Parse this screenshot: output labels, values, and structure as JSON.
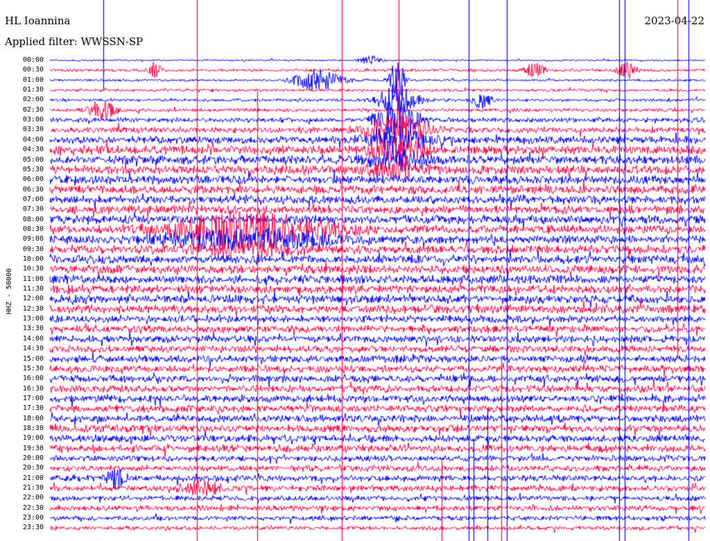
{
  "header": {
    "station": "HL Ioannina",
    "filter_prefix": "Applied filter: ",
    "filter_name": "WWSSN-SP",
    "date": "2023-04-22"
  },
  "chart_data": {
    "type": "line",
    "subtype": "helicorder",
    "title": "HL Ioannina",
    "date": "2023-04-22",
    "filter": "WWSSN-SP",
    "ylabel": "HHZ - 50000",
    "grid": false,
    "row_interval_minutes": 30,
    "alternating_colors": [
      "#0000ff",
      "#ff0040"
    ],
    "colors": {
      "blue_trace": "#0000ff",
      "red_trace": "#ff0040"
    },
    "time_labels": [
      "00:00",
      "00:30",
      "01:00",
      "01:30",
      "02:00",
      "02:30",
      "03:00",
      "03:30",
      "04:00",
      "04:30",
      "05:00",
      "05:30",
      "06:00",
      "06:30",
      "07:00",
      "07:30",
      "08:00",
      "08:30",
      "09:00",
      "09:30",
      "10:00",
      "10:30",
      "11:00",
      "11:30",
      "12:00",
      "12:30",
      "13:00",
      "13:30",
      "14:00",
      "14:30",
      "15:00",
      "15:30",
      "16:00",
      "16:30",
      "17:00",
      "17:30",
      "18:00",
      "18:30",
      "19:00",
      "19:30",
      "20:00",
      "20:30",
      "21:00",
      "21:30",
      "22:00",
      "22:30",
      "23:00",
      "23:30"
    ],
    "noise_amplitude_by_row": [
      1.5,
      2.5,
      2,
      2.5,
      2.5,
      3,
      4,
      5,
      6,
      7,
      7,
      7,
      7,
      7,
      7,
      7,
      7,
      7,
      7,
      7,
      7,
      7,
      7,
      7,
      7,
      7,
      6,
      6,
      6,
      6,
      6,
      6,
      6,
      6,
      6,
      6,
      6,
      6,
      6,
      6,
      5,
      5,
      5,
      5,
      4.5,
      4.5,
      4,
      3.5
    ],
    "events": [
      {
        "row": 0,
        "x_fraction": 0.49,
        "amplitude": 8,
        "duration_fraction": 0.01
      },
      {
        "row": 1,
        "x_fraction": 0.16,
        "amplitude": 12,
        "duration_fraction": 0.006
      },
      {
        "row": 1,
        "x_fraction": 0.74,
        "amplitude": 10,
        "duration_fraction": 0.01
      },
      {
        "row": 1,
        "x_fraction": 0.88,
        "amplitude": 12,
        "duration_fraction": 0.01
      },
      {
        "row": 2,
        "x_fraction": 0.41,
        "amplitude": 16,
        "duration_fraction": 0.025
      },
      {
        "row": 2,
        "x_fraction": 0.53,
        "amplitude": 30,
        "duration_fraction": 0.008
      },
      {
        "row": 4,
        "x_fraction": 0.53,
        "amplitude": 22,
        "duration_fraction": 0.02
      },
      {
        "row": 4,
        "x_fraction": 0.66,
        "amplitude": 12,
        "duration_fraction": 0.01
      },
      {
        "row": 5,
        "x_fraction": 0.08,
        "amplitude": 12,
        "duration_fraction": 0.015
      },
      {
        "row": 6,
        "x_fraction": 0.53,
        "amplitude": 30,
        "duration_fraction": 0.02
      },
      {
        "row": 7,
        "x_fraction": 0.53,
        "amplitude": 25,
        "duration_fraction": 0.03
      },
      {
        "row": 8,
        "x_fraction": 0.53,
        "amplitude": 20,
        "duration_fraction": 0.03
      },
      {
        "row": 9,
        "x_fraction": 0.53,
        "amplitude": 16,
        "duration_fraction": 0.03
      },
      {
        "row": 10,
        "x_fraction": 0.53,
        "amplitude": 12,
        "duration_fraction": 0.03
      },
      {
        "row": 11,
        "x_fraction": 0.53,
        "amplitude": 10,
        "duration_fraction": 0.03
      },
      {
        "row": 17,
        "x_fraction": 0.3,
        "amplitude": 22,
        "duration_fraction": 0.08
      },
      {
        "row": 18,
        "x_fraction": 0.3,
        "amplitude": 14,
        "duration_fraction": 0.08
      },
      {
        "row": 19,
        "x_fraction": 0.3,
        "amplitude": 8,
        "duration_fraction": 0.06
      },
      {
        "row": 42,
        "x_fraction": 0.1,
        "amplitude": 12,
        "duration_fraction": 0.01
      },
      {
        "row": 43,
        "x_fraction": 0.23,
        "amplitude": 8,
        "duration_fraction": 0.02
      }
    ],
    "spikes": [
      {
        "x_fraction": 0.081,
        "color": "#0000ff",
        "from_row": -1,
        "to_row": 3
      },
      {
        "x_fraction": 0.224,
        "color": "#ff0040",
        "from_row": -1,
        "to_row": 52
      },
      {
        "x_fraction": 0.316,
        "color": "#ff0040",
        "from_row": 3,
        "to_row": 52
      },
      {
        "x_fraction": 0.446,
        "color": "#ff0040",
        "from_row": -1,
        "to_row": 52
      },
      {
        "x_fraction": 0.532,
        "color": "#ff0040",
        "from_row": -1,
        "to_row": 6
      },
      {
        "x_fraction": 0.598,
        "color": "#ff0040",
        "from_row": 40,
        "to_row": 52
      },
      {
        "x_fraction": 0.639,
        "color": "#0000ff",
        "from_row": -1,
        "to_row": 52
      },
      {
        "x_fraction": 0.647,
        "color": "#0000ff",
        "from_row": 38,
        "to_row": 52
      },
      {
        "x_fraction": 0.668,
        "color": "#0000ff",
        "from_row": 35,
        "to_row": 52
      },
      {
        "x_fraction": 0.689,
        "color": "#ff0040",
        "from_row": 30,
        "to_row": 52
      },
      {
        "x_fraction": 0.697,
        "color": "#0000ff",
        "from_row": -1,
        "to_row": 52
      },
      {
        "x_fraction": 0.869,
        "color": "#0000ff",
        "from_row": -1,
        "to_row": 52
      },
      {
        "x_fraction": 0.877,
        "color": "#0000ff",
        "from_row": -1,
        "to_row": 52
      },
      {
        "x_fraction": 0.958,
        "color": "#ff0040",
        "from_row": -1,
        "to_row": 30
      },
      {
        "x_fraction": 0.975,
        "color": "#0000ff",
        "from_row": -1,
        "to_row": 52
      }
    ]
  }
}
